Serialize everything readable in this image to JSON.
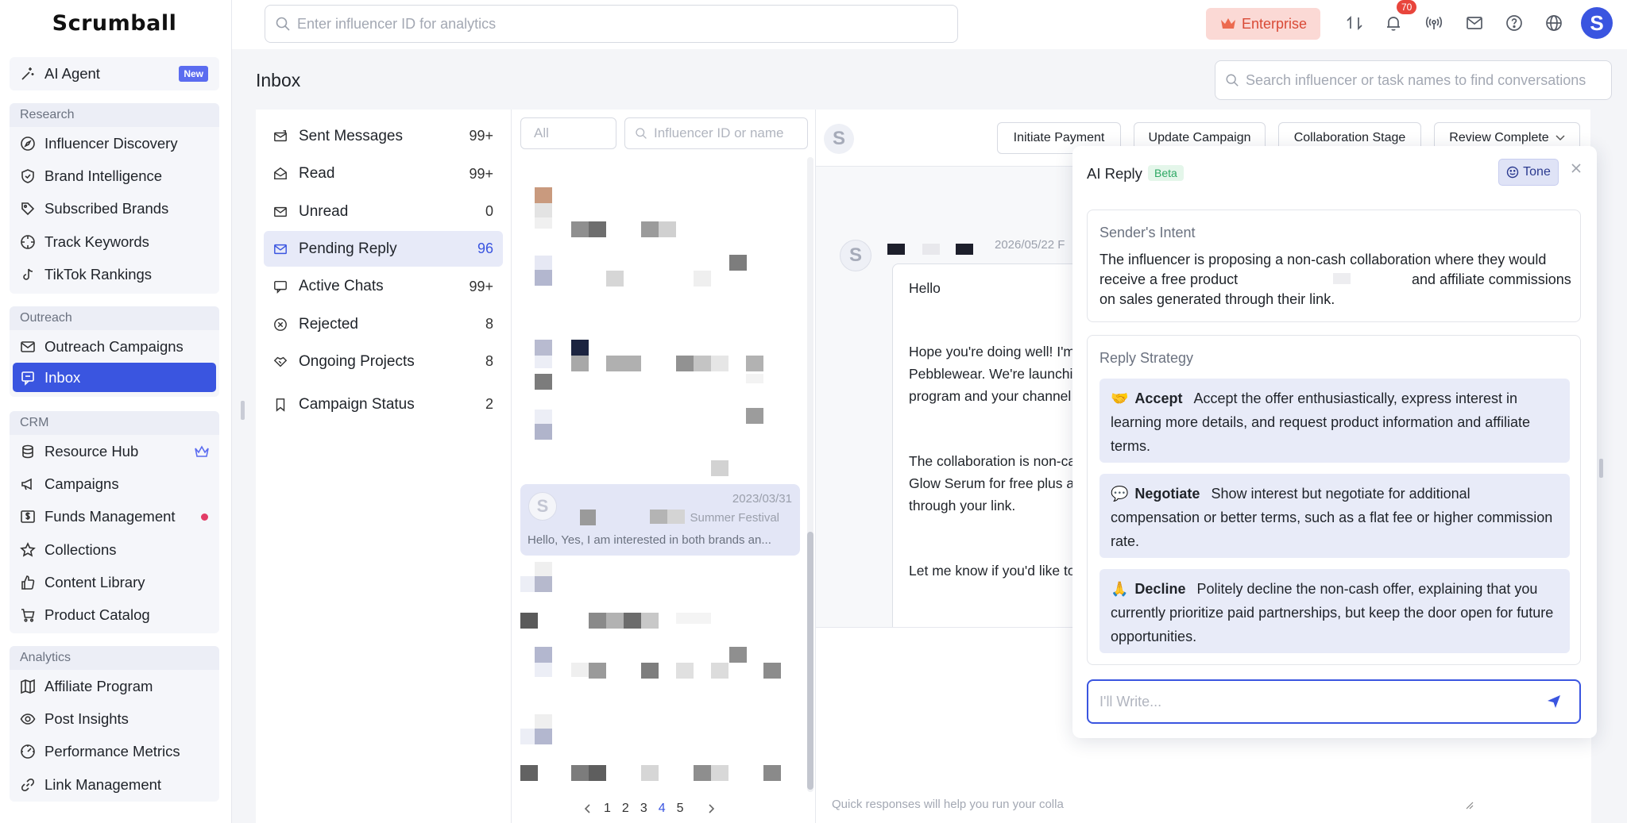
{
  "app": {
    "logo": "Scrumball"
  },
  "sidebar": {
    "top_item": {
      "label": "AI Agent",
      "badge": "New"
    },
    "groups": [
      {
        "title": "Research",
        "items": [
          "Influencer Discovery",
          "Brand Intelligence",
          "Subscribed Brands",
          "Track Keywords",
          "TikTok Rankings"
        ]
      },
      {
        "title": "Outreach",
        "items": [
          "Outreach Campaigns",
          "Inbox"
        ]
      },
      {
        "title": "CRM",
        "items": [
          "Resource Hub",
          "Campaigns",
          "Funds Management",
          "Collections",
          "Content Library",
          "Product Catalog"
        ]
      },
      {
        "title": "Analytics",
        "items": [
          "Affiliate Program",
          "Post Insights",
          "Performance Metrics",
          "Link Management"
        ]
      }
    ],
    "active_item": "Inbox"
  },
  "topbar": {
    "search_placeholder": "Enter influencer ID for analytics",
    "enterprise_label": "Enterprise",
    "notification_count": "70",
    "avatar_letter": "S",
    "icons": [
      "transfer-icon",
      "bell-icon",
      "broadcast-icon",
      "mail-icon",
      "help-icon",
      "globe-icon"
    ]
  },
  "inbox": {
    "title": "Inbox",
    "conversation_search_placeholder": "Search influencer or task names to find conversations",
    "folders": [
      {
        "label": "Sent Messages",
        "count": "99+"
      },
      {
        "label": "Read",
        "count": "99+"
      },
      {
        "label": "Unread",
        "count": "0"
      },
      {
        "label": "Pending Reply",
        "count": "96"
      },
      {
        "label": "Active Chats",
        "count": "99+"
      },
      {
        "label": "Rejected",
        "count": "8"
      },
      {
        "label": "Ongoing Projects",
        "count": "8"
      },
      {
        "label": "Campaign Status",
        "count": "2"
      }
    ],
    "active_folder": "Pending Reply"
  },
  "conversation_list": {
    "filter_placeholder": "All",
    "search_placeholder": "Influencer ID or name",
    "selected": {
      "avatar_letter": "S",
      "date": "2023/03/31",
      "campaign": "Summer Festival",
      "preview": "Hello, Yes, I am interested in both brands an..."
    },
    "pagination": {
      "pages": [
        "1",
        "2",
        "3",
        "4",
        "5"
      ],
      "current": "4"
    }
  },
  "chat": {
    "avatar_letter": "S",
    "actions": [
      "Initiate Payment",
      "Update Campaign",
      "Collaboration Stage",
      "Review Complete"
    ],
    "message": {
      "date": "2026/05/22 F",
      "greeting": "Hello",
      "p1": "Hope you're doing well! I'm\nPebblewear. We're launchi\nprogram and your channel",
      "p2": "The collaboration is non-ca\nGlow Serum for free plus a\nthrough your link.",
      "p3": "Let me know if you'd like to"
    },
    "quick_hint": "Quick responses will help you run your colla"
  },
  "ai_reply": {
    "title": "AI Reply",
    "beta": "Beta",
    "tone_label": "Tone",
    "intent_title": "Sender's Intent",
    "intent_line1": "The influencer is proposing a non-cash collaboration where they would",
    "intent_line2a": "receive a free product",
    "intent_line2b": "and affiliate commissions",
    "intent_line3": "on sales generated through their link.",
    "strategy_title": "Reply Strategy",
    "strategies": [
      {
        "emoji": "🤝",
        "label": "Accept",
        "text": "Accept the offer enthusiastically, express interest in learning more details, and request product information and affiliate terms."
      },
      {
        "emoji": "💬",
        "label": "Negotiate",
        "text": "Show interest but negotiate for additional compensation or better terms, such as a flat fee or higher commission rate."
      },
      {
        "emoji": "🙏",
        "label": "Decline",
        "text": "Politely decline the non-cash offer, explaining that you currently prioritize paid partnerships, but keep the door open for future opportunities."
      }
    ],
    "write_placeholder": "I'll Write..."
  }
}
